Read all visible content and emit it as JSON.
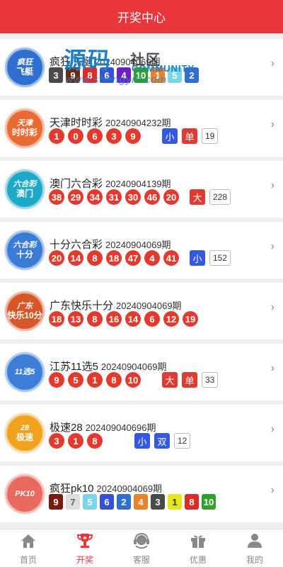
{
  "header": {
    "title": "开奖中心"
  },
  "watermark": {
    "big": "源码",
    "small": "社区",
    "community": "COMMUNITY",
    "url": "www.shengym.com"
  },
  "lotteries": [
    {
      "name": "疯狂飞艇",
      "issue": "20240904069期",
      "logo": {
        "line1": "疯狂",
        "line2": "飞艇",
        "color": "#2f6fcf"
      },
      "kind": "squares",
      "numbers": [
        {
          "n": "3",
          "color": "#4a4a4a"
        },
        {
          "n": "9",
          "color": "#6b2a12"
        },
        {
          "n": "8",
          "color": "#e02a2a"
        },
        {
          "n": "6",
          "color": "#3650d8"
        },
        {
          "n": "4",
          "color": "#6b20c8"
        },
        {
          "n": "10",
          "color": "#2fa12a"
        },
        {
          "n": "1",
          "color": "#e8832a"
        },
        {
          "n": "5",
          "color": "#7ad6e6"
        },
        {
          "n": "2",
          "color": "#2f6fcf"
        }
      ]
    },
    {
      "name": "天津时时彩",
      "issue": "20240904232期",
      "logo": {
        "line1": "天津",
        "line2": "时时彩",
        "color": "#ea6a34"
      },
      "kind": "balls",
      "numbers": [
        "1",
        "0",
        "6",
        "3",
        "9"
      ],
      "tags": [
        {
          "t": "小",
          "c": "blue"
        },
        {
          "t": "单",
          "c": "red"
        }
      ],
      "sum": "19"
    },
    {
      "name": "澳门六合彩",
      "issue": "20240904139期",
      "logo": {
        "line1": "六合彩",
        "line2": "澳门",
        "color": "#1fa9c8"
      },
      "kind": "balls",
      "numbers": [
        "38",
        "29",
        "34",
        "31",
        "30",
        "46",
        "20"
      ],
      "tags": [
        {
          "t": "大",
          "c": "red"
        }
      ],
      "sum": "228"
    },
    {
      "name": "十分六合彩",
      "issue": "20240904069期",
      "logo": {
        "line1": "六合彩",
        "line2": "十分",
        "color": "#3a7bd5"
      },
      "kind": "balls",
      "numbers": [
        "20",
        "14",
        "8",
        "18",
        "47",
        "4",
        "41"
      ],
      "tags": [
        {
          "t": "小",
          "c": "blue"
        }
      ],
      "sum": "152"
    },
    {
      "name": "广东快乐十分",
      "issue": "20240904069期",
      "logo": {
        "line1": "广东",
        "line2": "快乐10分",
        "color": "#d8572a"
      },
      "kind": "balls",
      "numbers": [
        "18",
        "13",
        "8",
        "16",
        "14",
        "6",
        "12",
        "19"
      ],
      "tags": [],
      "sum": ""
    },
    {
      "name": "江苏11选5",
      "issue": "20240904069期",
      "logo": {
        "line1": "11选5",
        "line2": "",
        "color": "#3d7fd8"
      },
      "kind": "balls",
      "numbers": [
        "9",
        "5",
        "1",
        "8",
        "10"
      ],
      "tags": [
        {
          "t": "大",
          "c": "red"
        },
        {
          "t": "单",
          "c": "red"
        }
      ],
      "sum": "33"
    },
    {
      "name": "极速28",
      "issue": "20240904069​6期",
      "logo": {
        "line1": "28",
        "line2": "极速",
        "color": "#f0a21e"
      },
      "kind": "balls",
      "numbers": [
        "3",
        "1",
        "8"
      ],
      "tags": [
        {
          "t": "小",
          "c": "blue"
        },
        {
          "t": "双",
          "c": "blue"
        }
      ],
      "sum": "12"
    },
    {
      "name": "疯狂pk10",
      "issue": "20240904069期",
      "logo": {
        "line1": "PK10",
        "line2": "",
        "color": "#e86a5e"
      },
      "kind": "squares",
      "numbers": [
        {
          "n": "9",
          "color": "#7a1a10"
        },
        {
          "n": "7",
          "color": "#dddddd"
        },
        {
          "n": "5",
          "color": "#7ad6e6"
        },
        {
          "n": "6",
          "color": "#3650d8"
        },
        {
          "n": "2",
          "color": "#2f6fcf"
        },
        {
          "n": "4",
          "color": "#e8832a"
        },
        {
          "n": "3",
          "color": "#4a4a4a"
        },
        {
          "n": "1",
          "color": "#e6e61a"
        },
        {
          "n": "8",
          "color": "#e02a2a"
        },
        {
          "n": "10",
          "color": "#2fa12a"
        }
      ]
    }
  ],
  "tabbar": [
    {
      "label": "首页",
      "icon": "home-icon",
      "active": false
    },
    {
      "label": "开奖",
      "icon": "trophy-icon",
      "active": true
    },
    {
      "label": "客服",
      "icon": "headset-icon",
      "active": false
    },
    {
      "label": "优惠",
      "icon": "gift-icon",
      "active": false
    },
    {
      "label": "我的",
      "icon": "user-icon",
      "active": false
    }
  ]
}
